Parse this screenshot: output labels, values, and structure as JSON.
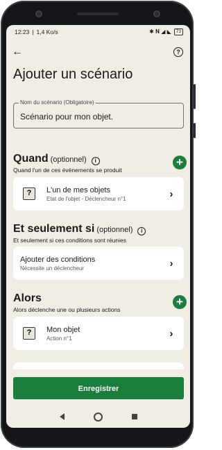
{
  "status_bar": {
    "time": "12:23",
    "speed": "1,4 Ko/s",
    "icons": "✱ 𝐍 ◢ ◣",
    "battery": "73"
  },
  "header": {
    "title": "Ajouter un scénario"
  },
  "scenario_name": {
    "label": "Nom du scénario (Obligatoire)",
    "value": "Scénario pour mon objet."
  },
  "quand": {
    "title": "Quand",
    "optional": "(optionnel)",
    "subtitle": "Quand l'un de ces évènements se produit",
    "card": {
      "title": "L'un de mes objets",
      "subtitle": "Etat de l'objet - Déclencheur n°1"
    }
  },
  "seulement": {
    "title": "Et seulement si",
    "optional": "(optionnel)",
    "subtitle": "Et seulement si ces conditions sont réunies",
    "card": {
      "title": "Ajouter des conditions",
      "subtitle": "Nécessite un déclencheur"
    }
  },
  "alors": {
    "title": "Alors",
    "subtitle": "Alors déclenche une ou plusieurs actions",
    "card": {
      "title": "Mon objet",
      "subtitle": "Action n°1"
    }
  },
  "footer": {
    "save_label": "Enregistrer"
  },
  "colors": {
    "accent": "#1a7f3c",
    "background": "#f1ede4"
  }
}
